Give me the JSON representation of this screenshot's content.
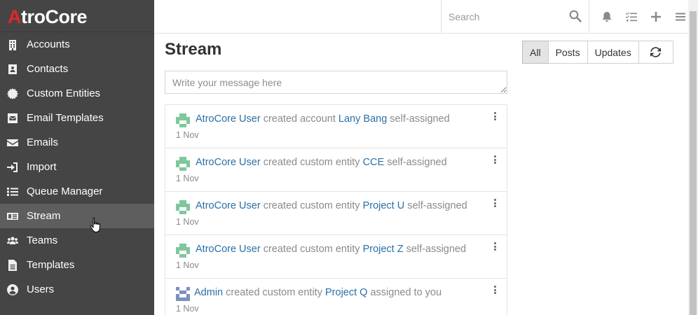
{
  "app": {
    "logo_prefix": "A",
    "logo_rest": "troCore"
  },
  "sidebar": {
    "items": [
      {
        "label": "Accounts",
        "icon": "building-icon"
      },
      {
        "label": "Contacts",
        "icon": "contact-card-icon"
      },
      {
        "label": "Custom Entities",
        "icon": "gear-badge-icon"
      },
      {
        "label": "Email Templates",
        "icon": "envelope-square-icon"
      },
      {
        "label": "Emails",
        "icon": "envelope-icon"
      },
      {
        "label": "Import",
        "icon": "sign-in-icon"
      },
      {
        "label": "Queue Manager",
        "icon": "tasks-list-icon"
      },
      {
        "label": "Stream",
        "icon": "newspaper-icon",
        "active": true
      },
      {
        "label": "Teams",
        "icon": "users-icon"
      },
      {
        "label": "Templates",
        "icon": "file-text-icon"
      },
      {
        "label": "Users",
        "icon": "user-circle-icon"
      }
    ]
  },
  "topbar": {
    "search_placeholder": "Search",
    "icons": [
      "bell-icon",
      "task-list-icon",
      "plus-icon",
      "menu-icon"
    ]
  },
  "main": {
    "title": "Stream",
    "filters": {
      "all": "All",
      "posts": "Posts",
      "updates": "Updates"
    },
    "message_placeholder": "Write your message here",
    "notes": [
      {
        "user": "AtroCore User",
        "action": "created account",
        "target": "Lany Bang",
        "suffix": "self-assigned",
        "date": "1 Nov",
        "avatar": "green"
      },
      {
        "user": "AtroCore User",
        "action": "created custom entity",
        "target": "CCE",
        "suffix": "self-assigned",
        "date": "1 Nov",
        "avatar": "green"
      },
      {
        "user": "AtroCore User",
        "action": "created custom entity",
        "target": "Project U",
        "suffix": "self-assigned",
        "date": "1 Nov",
        "avatar": "green"
      },
      {
        "user": "AtroCore User",
        "action": "created custom entity",
        "target": "Project Z",
        "suffix": "self-assigned",
        "date": "1 Nov",
        "avatar": "green"
      },
      {
        "user": "Admin",
        "action": "created custom entity",
        "target": "Project Q",
        "suffix": "assigned to you",
        "date": "1 Nov",
        "avatar": "blue"
      }
    ]
  },
  "colors": {
    "sidebar_bg": "#454545",
    "link": "#2a6fa6",
    "logo_accent": "#e0262e"
  }
}
